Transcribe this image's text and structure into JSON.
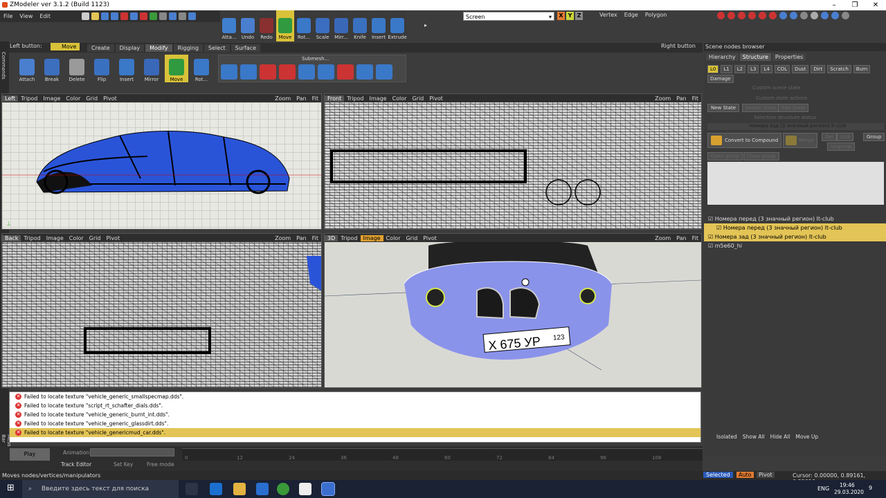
{
  "app": {
    "title": "ZModeler ver 3.1.2 (Build 1123)",
    "window_controls": [
      "–",
      "❐",
      "✕"
    ]
  },
  "menu": [
    "File",
    "View",
    "Edit"
  ],
  "toolbar": {
    "tools": [
      {
        "label": "Atta...",
        "color": "#3f7fd0"
      },
      {
        "label": "Undo",
        "color": "#4a7fcf"
      },
      {
        "label": "Redo",
        "color": "#8a3030"
      },
      {
        "label": "Move",
        "color": "#2f9a3f",
        "active": true
      },
      {
        "label": "Rot...",
        "color": "#3a78c8"
      },
      {
        "label": "Scale",
        "color": "#3b6ec0"
      },
      {
        "label": "Mirr...",
        "color": "#3a68b8"
      },
      {
        "label": "Knife",
        "color": "#3a70c0"
      },
      {
        "label": "Insert",
        "color": "#3a78c8"
      },
      {
        "label": "Extrude",
        "color": "#3a78c8"
      }
    ],
    "screen_select": "Screen",
    "axes": [
      "X",
      "Y",
      "Z"
    ],
    "sel_modes": [
      "Vertex",
      "Edge",
      "Polygon"
    ]
  },
  "modify": {
    "left_button": "Left button:",
    "left_value": "Move",
    "right_button": "Right button",
    "tabs": [
      "Create",
      "Display",
      "Modify",
      "Rigging",
      "Select",
      "Surface"
    ],
    "active_tab": "Modify",
    "tools": [
      {
        "label": "Attach",
        "color": "#4a7fcf"
      },
      {
        "label": "Break",
        "color": "#3d6fbf"
      },
      {
        "label": "Delete",
        "color": "#9a9a9a"
      },
      {
        "label": "Flip",
        "color": "#3a70c0"
      },
      {
        "label": "Insert",
        "color": "#3a78c8"
      },
      {
        "label": "Mirror",
        "color": "#3a68b8"
      },
      {
        "label": "Move",
        "color": "#2f9a3f",
        "active": true
      },
      {
        "label": "Rot...",
        "color": "#3a78c8"
      },
      {
        "label": "Scale",
        "color": "#3b6ec0"
      }
    ],
    "submesh_label": "Submesh..."
  },
  "viewports": {
    "left": {
      "name": "Left",
      "items": [
        "Tripod",
        "Image",
        "Color",
        "Grid",
        "Pivot"
      ],
      "zoom": "Zoom",
      "pan": "Pan",
      "fit": "Fit"
    },
    "front": {
      "name": "Front",
      "items": [
        "Tripod",
        "Image",
        "Color",
        "Grid",
        "Pivot"
      ],
      "zoom": "Zoom",
      "pan": "Pan",
      "fit": "Fit"
    },
    "back": {
      "name": "Back",
      "items": [
        "Tripod",
        "Image",
        "Color",
        "Grid",
        "Pivot"
      ],
      "zoom": "Zoom",
      "pan": "Pan",
      "fit": "Fit"
    },
    "3d": {
      "name": "3D",
      "items": [
        "Tripod",
        "Image",
        "Color",
        "Grid",
        "Pivot"
      ],
      "zoom": "Zoom",
      "pan": "Pan",
      "fit": "Fit",
      "plate": "X 675 УР",
      "plate_region": "123"
    }
  },
  "scene": {
    "title": "Scene nodes browser",
    "tabs": [
      "Hierarchy",
      "Structure",
      "Properties"
    ],
    "active_tab": "Structure",
    "lods": [
      "L0",
      "L1",
      "L2",
      "L3",
      "L4",
      "COL",
      "Dust",
      "Dirt",
      "Scratch",
      "Burn"
    ],
    "damage": "Damage",
    "custom_state": "Custom scene state",
    "custom_state_actions": "Custom state actions",
    "buttons": {
      "new_state": "New State",
      "delete_state": "Delete State",
      "edit_state": "Edit State"
    },
    "selection_state": "Selection structure status",
    "selected_node": "Номера зад (3 значный регион) lt-club",
    "convert": "Convert to Compound",
    "merge": "Merge",
    "del": "Del",
    "link": "Link",
    "group": "Group",
    "ungroup": "Ungroup",
    "open_group": "Open group",
    "close_group": "Close group",
    "tree": [
      {
        "label": "Номера перед (3 значный регион) lt-club",
        "indent": 0,
        "hl": false
      },
      {
        "label": "Номера перед (3 значный регион) lt-club",
        "indent": 1,
        "hl": true
      },
      {
        "label": "Номера зад (3 значный регион) lt-club",
        "indent": 0,
        "hl": true
      },
      {
        "label": "m5e60_hi",
        "indent": 0,
        "hl": false
      }
    ],
    "footer": [
      "Isolated",
      "Show All",
      "Hide All",
      "Move Up"
    ]
  },
  "log": [
    {
      "text": "Failed to locate texture \"vehicle_generic_smallspecmap.dds\".",
      "hl": false
    },
    {
      "text": "Failed to locate texture \"script_rt_schafter_dials.dds\".",
      "hl": false
    },
    {
      "text": "Failed to locate texture \"vehicle_generic_burnt_int.dds\".",
      "hl": false
    },
    {
      "text": "Failed to locate texture \"vehicle_generic_glassdirt.dds\".",
      "hl": false
    },
    {
      "text": "Failed to locate texture \"vehicle_genericmud_car.dds\".",
      "hl": true
    }
  ],
  "anim": {
    "play": "Play",
    "animation_label": "Animation:",
    "track_editor": "Track Editor",
    "set_key": "Set Key",
    "free_mode": "Free mode",
    "ticks": [
      "0",
      "12",
      "24",
      "36",
      "48",
      "60",
      "72",
      "84",
      "96",
      "108"
    ]
  },
  "status": {
    "hint": "Moves nodes/vertices/manipulators",
    "selected": "Selected",
    "auto": "Auto",
    "pivot": "Pivot",
    "cursor": "Cursor: 0.00000, 0.89161, 0.55010"
  },
  "taskbar": {
    "search_placeholder": "Введите здесь текст для поиска",
    "lang": "ENG",
    "time": "19:46",
    "date": "29.03.2020",
    "notif": "9"
  },
  "side_labels": {
    "commands": "Commands",
    "messaging": "Messaging Bar"
  }
}
